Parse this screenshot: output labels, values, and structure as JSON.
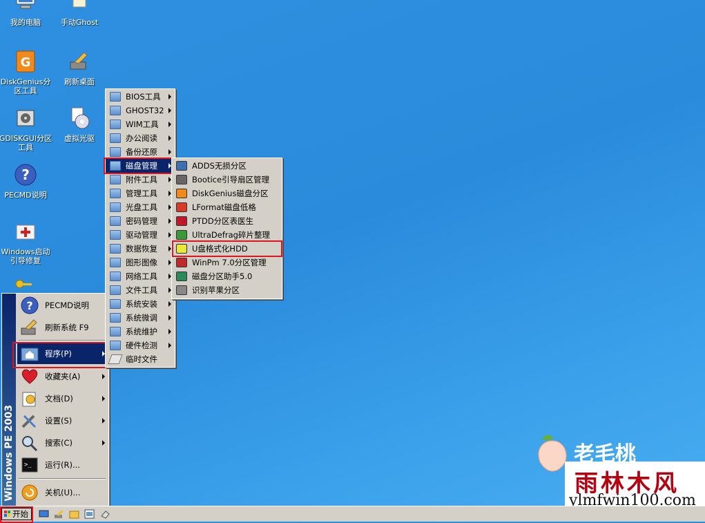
{
  "desktop": {
    "icons": [
      {
        "label": "我的电脑",
        "icon": "computer-icon"
      },
      {
        "label": "手动Ghost",
        "icon": "ghost-icon"
      },
      {
        "label": "DiskGenius分区工具",
        "icon": "diskgenius-icon"
      },
      {
        "label": "刷新桌面",
        "icon": "broom-icon"
      },
      {
        "label": "GDISKGUI分区工具",
        "icon": "gdisk-icon"
      },
      {
        "label": "虚拟光驱",
        "icon": "virtual-drive-icon"
      },
      {
        "label": "PECMD说明",
        "icon": "help-icon"
      },
      {
        "label": "Windows启动引导修复",
        "icon": "first-aid-icon"
      }
    ]
  },
  "programs_menu": {
    "items": [
      {
        "label": "BIOS工具",
        "submenu": true
      },
      {
        "label": "GHOST32",
        "submenu": true
      },
      {
        "label": "WIM工具",
        "submenu": true
      },
      {
        "label": "办公阅读",
        "submenu": true
      },
      {
        "label": "备份还原",
        "submenu": true
      },
      {
        "label": "磁盘管理",
        "submenu": true,
        "selected": true
      },
      {
        "label": "附件工具",
        "submenu": true
      },
      {
        "label": "管理工具",
        "submenu": true
      },
      {
        "label": "光盘工具",
        "submenu": true
      },
      {
        "label": "密码管理",
        "submenu": true
      },
      {
        "label": "驱动管理",
        "submenu": true
      },
      {
        "label": "数据恢复",
        "submenu": true
      },
      {
        "label": "图形图像",
        "submenu": true
      },
      {
        "label": "网络工具",
        "submenu": true
      },
      {
        "label": "文件工具",
        "submenu": true
      },
      {
        "label": "系统安装",
        "submenu": true
      },
      {
        "label": "系统微调",
        "submenu": true
      },
      {
        "label": "系统维护",
        "submenu": true
      },
      {
        "label": "硬件检测",
        "submenu": true
      },
      {
        "label": "临时文件",
        "submenu": false
      }
    ]
  },
  "disk_menu": {
    "items": [
      {
        "label": "ADDS无损分区",
        "icon": "adds-icon"
      },
      {
        "label": "Bootice引导扇区管理",
        "icon": "bootice-icon"
      },
      {
        "label": "DiskGenius磁盘分区",
        "icon": "diskgenius-icon"
      },
      {
        "label": "LFormat磁盘低格",
        "icon": "lformat-icon"
      },
      {
        "label": "PTDD分区表医生",
        "icon": "ptdd-icon"
      },
      {
        "label": "UltraDefrag碎片整理",
        "icon": "defrag-icon"
      },
      {
        "label": "U盘格式化HDD",
        "icon": "usb-format-icon",
        "highlighted": true
      },
      {
        "label": "WinPm 7.0分区管理",
        "icon": "winpm-icon"
      },
      {
        "label": "磁盘分区助手5.0",
        "icon": "partition-assistant-icon"
      },
      {
        "label": "识别苹果分区",
        "icon": "apple-partition-icon"
      }
    ]
  },
  "start_menu": {
    "banner": "Windows PE 2003",
    "items": [
      {
        "label": "PECMD说明",
        "icon": "help-icon",
        "submenu": false
      },
      {
        "label": "刷新系统 F9",
        "icon": "broom-icon",
        "submenu": false
      },
      {
        "label": "程序(P)",
        "icon": "programs-icon",
        "submenu": true,
        "selected": true
      },
      {
        "label": "收藏夹(A)",
        "icon": "heart-icon",
        "submenu": true
      },
      {
        "label": "文档(D)",
        "icon": "documents-icon",
        "submenu": true
      },
      {
        "label": "设置(S)",
        "icon": "settings-icon",
        "submenu": true
      },
      {
        "label": "搜索(C)",
        "icon": "search-icon",
        "submenu": true
      },
      {
        "label": "运行(R)...",
        "icon": "run-icon",
        "submenu": false
      },
      {
        "label": "关机(U)...",
        "icon": "shutdown-icon",
        "submenu": false
      }
    ]
  },
  "taskbar": {
    "start_label": "开始",
    "quick_launch": [
      "desktop-icon",
      "broom-icon",
      "folder-icon",
      "explorer-icon",
      "eraser-icon"
    ]
  },
  "branding": {
    "logo_text": "老毛桃",
    "watermark_cn": "雨林木风",
    "watermark_url": "ylmfwin100.com"
  },
  "colors": {
    "desktop": "#2a8bdc",
    "menu_bg": "#d4d0c8",
    "selection": "#0a246a",
    "highlight_box": "#e0141e"
  }
}
